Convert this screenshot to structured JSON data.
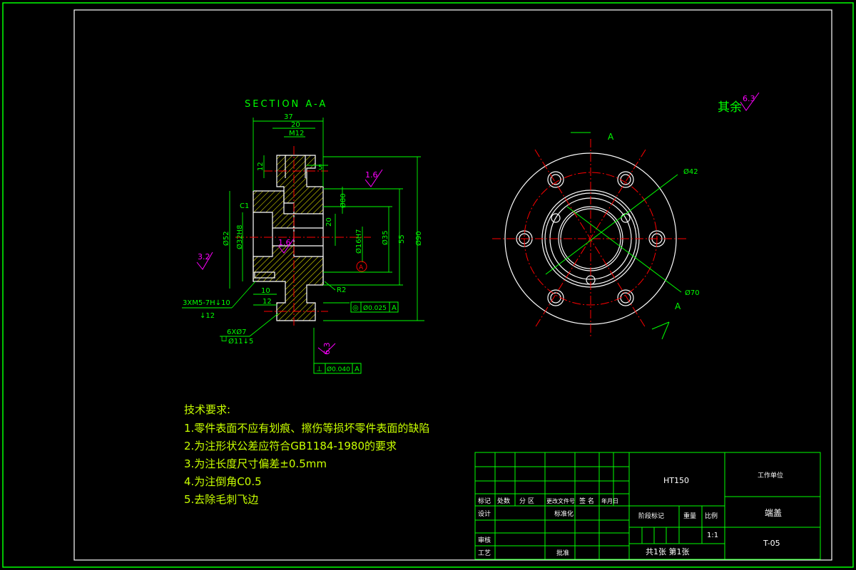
{
  "colors": {
    "background": "#000000",
    "frame": "#00ff00",
    "outline": "#ffffff",
    "centerline": "#ff0000",
    "dimension": "#00ff00",
    "roughness": "#ff00ff",
    "hatch": "#ffff00",
    "notes": "#c8ff00"
  },
  "section": {
    "title": "SECTION A-A",
    "dims": {
      "d37": "37",
      "d20": "20",
      "m12": "M12",
      "d12_top": "12",
      "d5": "5",
      "d80": "Ø80",
      "d20_mid": "20",
      "d16h7": "Ø16H7",
      "d35": "Ø35",
      "d55": "55",
      "d90": "Ø90",
      "d52": "Ø52",
      "d32h8": "Ø32H8",
      "c1": "C1",
      "d10": "10",
      "d12_bot": "12",
      "r2": "R2"
    },
    "thread_note_1": "3XM5-7H↓10",
    "thread_note_2": "↓12",
    "holes_note_1": "6XØ7",
    "holes_note_2": "└┘Ø11↓5",
    "roughness": {
      "r16_top": "1.6",
      "r16_mid": "1.6",
      "r32": "3.2",
      "r63": "6.3"
    },
    "datum_label": "A",
    "tol_concentric": {
      "symbol": "◎",
      "value": "Ø0.025",
      "datum": "A"
    },
    "tol_perpendicular": {
      "symbol": "⊥",
      "value": "Ø0.040",
      "datum": "A"
    }
  },
  "plan_view": {
    "cut_label_top": "A",
    "cut_label_bottom": "A",
    "d42": "Ø42",
    "d70": "Ø70"
  },
  "general_roughness": {
    "label": "其余",
    "value": "6.3"
  },
  "tech_requirements": {
    "title": "技术要求:",
    "items": [
      "1.零件表面不应有划痕、擦伤等损坏零件表面的缺陷",
      "2.为注形状公差应符合GB1184-1980的要求",
      "3.为注长度尺寸偏差±0.5mm",
      "4.为注倒角C0.5",
      "5.去除毛刺飞边"
    ]
  },
  "title_block": {
    "material": "HT150",
    "company": "工作单位",
    "part_name": "端盖",
    "drawing_no": "T-05",
    "scale": "1:1",
    "sheets": "共1张  第1张",
    "headers": [
      "标记",
      "处数",
      "分  区",
      "更改文件号",
      "签  名",
      "年月日"
    ],
    "row_design": "设计",
    "row_standard": "标准化",
    "row_review": "审核",
    "row_process": "工艺",
    "row_approve": "批准",
    "stage_mark": "阶段标记",
    "weight": "重量",
    "ratio": "比例"
  }
}
